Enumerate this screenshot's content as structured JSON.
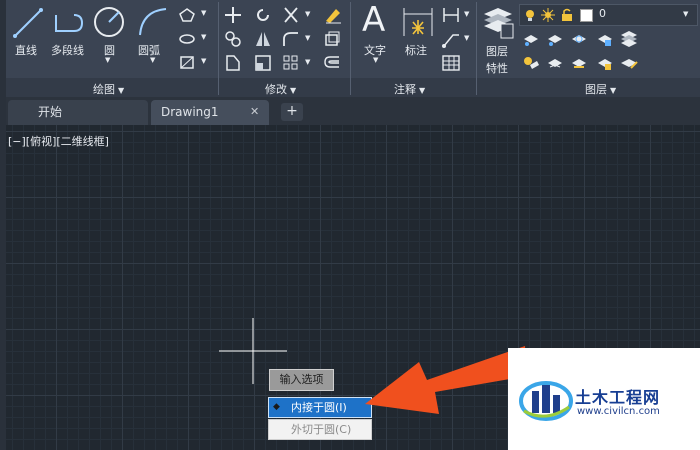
{
  "ribbon": {
    "draw_panel": {
      "title": "绘图",
      "tools": {
        "line": "直线",
        "polyline": "多段线",
        "circle": "圆",
        "arc": "圆弧"
      }
    },
    "modify_panel": {
      "title": "修改"
    },
    "annotation_panel": {
      "title": "注释",
      "tools": {
        "text": "文字",
        "dimension": "标注"
      }
    },
    "layers_panel": {
      "title": "图层",
      "layer_properties_line1": "图层",
      "layer_properties_line2": "特性",
      "current_layer": "0",
      "text_big_glyph": "A"
    }
  },
  "tabs": [
    {
      "label": "开始"
    },
    {
      "label": "Drawing1",
      "close": "✕"
    }
  ],
  "new_tab_symbol": "+",
  "viewport_label": "[−][俯视][二维线框]",
  "context_menu": {
    "header": "输入选项",
    "bullet": "◆",
    "options": [
      "内接于圆(I)",
      "外切于圆(C)"
    ]
  },
  "watermark": {
    "title": "土木工程网",
    "url": "www.civilcn.com"
  },
  "colors": {
    "ribbon_bg": "#3b4453",
    "canvas_bg": "#212830",
    "highlight": "#1e72c8",
    "arrow": "#f0501e",
    "watermark_blue": "#1f3f8c"
  }
}
